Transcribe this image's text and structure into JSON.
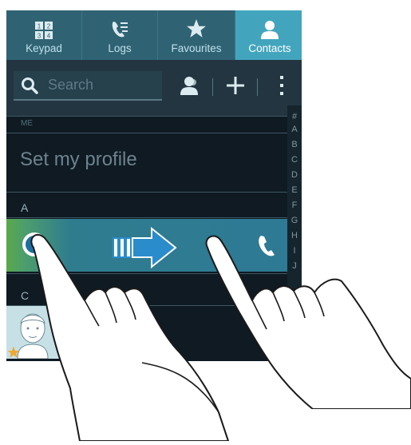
{
  "tabs": [
    {
      "label": "Keypad",
      "icon": "keypad-icon",
      "active": false
    },
    {
      "label": "Logs",
      "icon": "logs-icon",
      "active": false
    },
    {
      "label": "Favourites",
      "icon": "star-icon",
      "active": false
    },
    {
      "label": "Contacts",
      "icon": "contact-icon",
      "active": true
    }
  ],
  "keypad_digits": [
    "1",
    "2",
    "3",
    "4"
  ],
  "search": {
    "placeholder": "Search"
  },
  "toolbar": {
    "icons": [
      "add-contact-icon",
      "add-icon",
      "more-icon"
    ]
  },
  "list": {
    "me_header": "ME",
    "profile_label": "Set my profile",
    "section_a": "A",
    "section_c": "C",
    "c_partial": "C"
  },
  "index": [
    "#",
    "A",
    "B",
    "C",
    "D",
    "E",
    "F",
    "G",
    "H",
    "I",
    "J"
  ],
  "colors": {
    "tab_bar": "#2f6374",
    "tab_active": "#43a5bd",
    "row_swipe_start": "#5aa84a",
    "row_swipe_end": "#2e7a95",
    "arrow": "#2b8ccb"
  }
}
